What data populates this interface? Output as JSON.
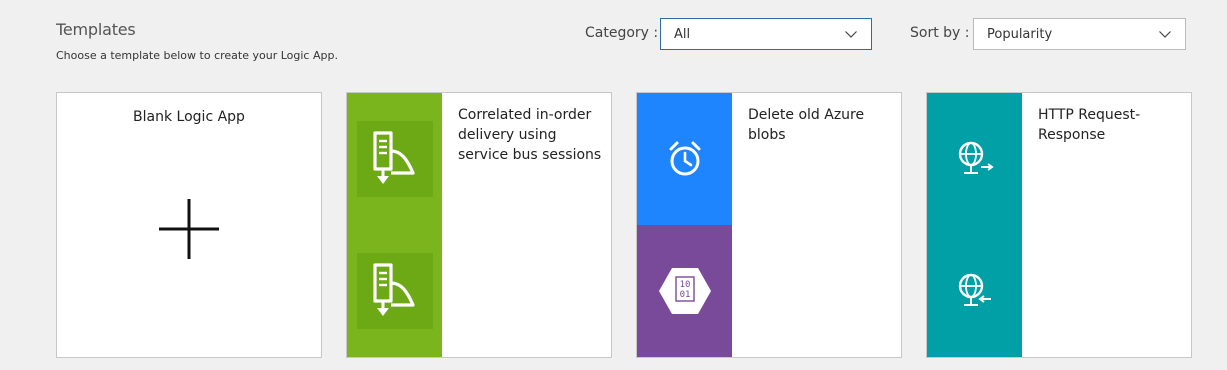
{
  "header": {
    "title": "Templates",
    "subtitle": "Choose a template below to create your Logic App."
  },
  "filters": {
    "category_label": "Category :",
    "category_value": "All",
    "sort_label": "Sort by :",
    "sort_value": "Popularity"
  },
  "cards": [
    {
      "title": "Blank Logic App"
    },
    {
      "title": "Correlated in-order delivery using service bus sessions",
      "top_color": "#7ab51d",
      "bottom_color": "#7ab51d",
      "top_icon": "service-bus-icon",
      "bottom_icon": "service-bus-icon"
    },
    {
      "title": "Delete old Azure blobs",
      "top_color": "#1f85ff",
      "bottom_color": "#7a4a9a",
      "top_icon": "alarm-clock-icon",
      "bottom_icon": "blob-storage-icon"
    },
    {
      "title": "HTTP Request-Response",
      "top_color": "#00a0a6",
      "bottom_color": "#00a0a6",
      "top_icon": "http-request-icon",
      "bottom_icon": "http-response-icon"
    }
  ],
  "blob_icon_text": {
    "line1": "10",
    "line2": "01"
  }
}
